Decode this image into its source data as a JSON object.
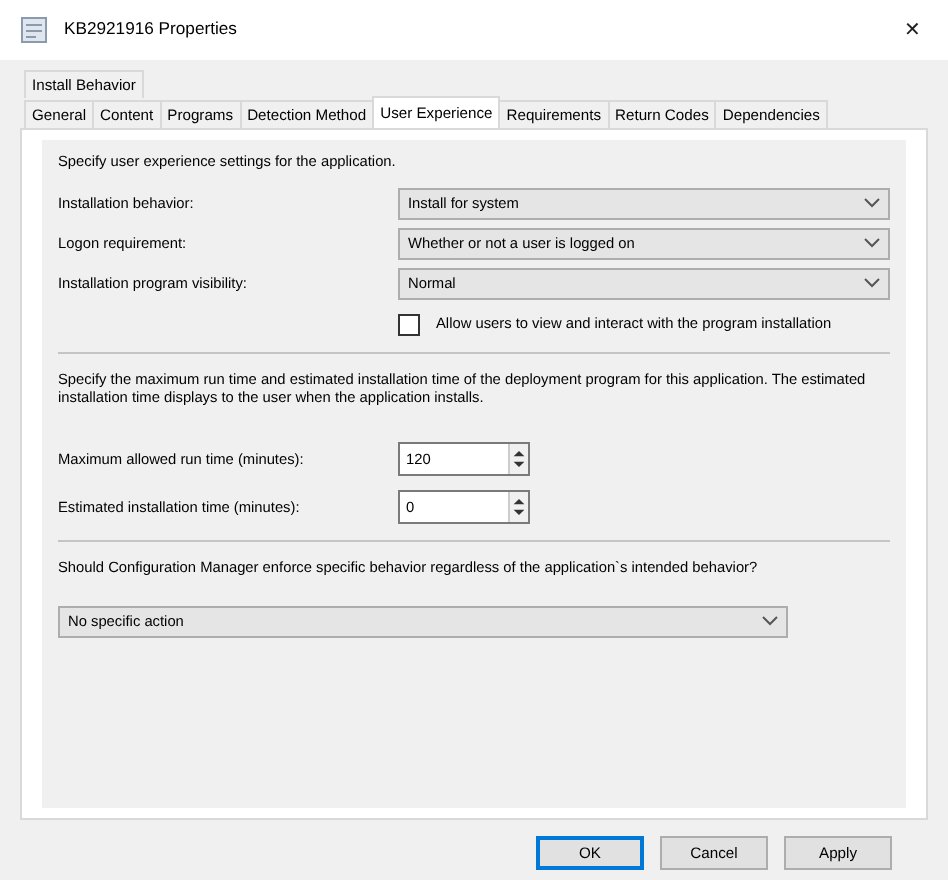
{
  "window": {
    "title": "KB2921916 Properties",
    "close": "✕"
  },
  "tab_rows": [
    [
      {
        "label": "Install Behavior",
        "selected": false
      }
    ],
    [
      {
        "label": "General",
        "selected": false
      },
      {
        "label": "Content",
        "selected": false
      },
      {
        "label": "Programs",
        "selected": false
      },
      {
        "label": "Detection Method",
        "selected": false
      },
      {
        "label": "User Experience",
        "selected": true
      },
      {
        "label": "Requirements",
        "selected": false
      },
      {
        "label": "Return Codes",
        "selected": false
      },
      {
        "label": "Dependencies",
        "selected": false
      }
    ]
  ],
  "intro": "Specify user experience settings for the application.",
  "settings": [
    {
      "label": "Installation behavior:",
      "value": "Install for system"
    },
    {
      "label": "Logon requirement:",
      "value": "Whether or not a user is logged on"
    },
    {
      "label": "Installation program visibility:",
      "value": "Normal"
    }
  ],
  "checkbox": {
    "label": "Allow users to view and interact with the program installation",
    "checked": false
  },
  "time_description": "Specify the maximum run time and estimated installation time of the deployment program for this application.  The estimated installation time displays to the user when the application installs.",
  "time_fields": [
    {
      "label": "Maximum allowed run time (minutes):",
      "value": "120"
    },
    {
      "label": "Estimated installation time (minutes):",
      "value": "0"
    }
  ],
  "enforce_question": "Should Configuration Manager enforce specific behavior regardless of the application`s intended behavior?",
  "enforce_value": "No specific action",
  "buttons": [
    {
      "label": "OK",
      "default": true
    },
    {
      "label": "Cancel",
      "default": false
    },
    {
      "label": "Apply",
      "default": false
    }
  ]
}
